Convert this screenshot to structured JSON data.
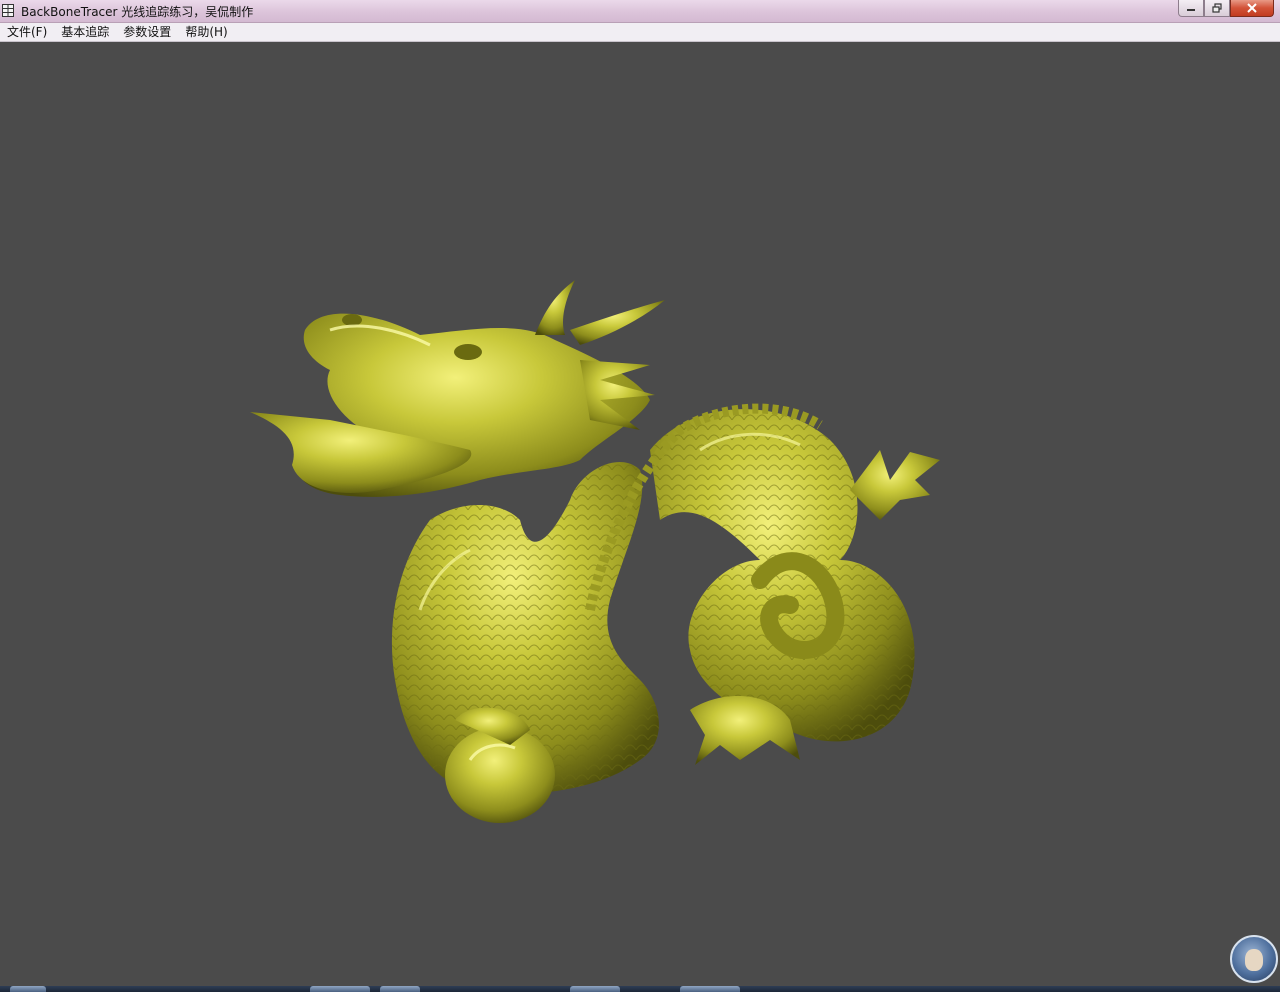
{
  "window": {
    "title": "BackBoneTracer 光线追踪练习，吴侃制作",
    "icon": "app-grid-icon",
    "controls": [
      "minimize-icon",
      "restore-icon",
      "close-icon"
    ]
  },
  "menu": {
    "file": "文件(F)",
    "basic_trace": "基本追踪",
    "param_settings": "参数设置",
    "help": "帮助(H)"
  },
  "viewport": {
    "background": "#4b4b4b",
    "object_color": "#b4b428",
    "render_subject": "dragon-render"
  },
  "taskbar": {
    "avatar_icon": "user-avatar-icon"
  }
}
